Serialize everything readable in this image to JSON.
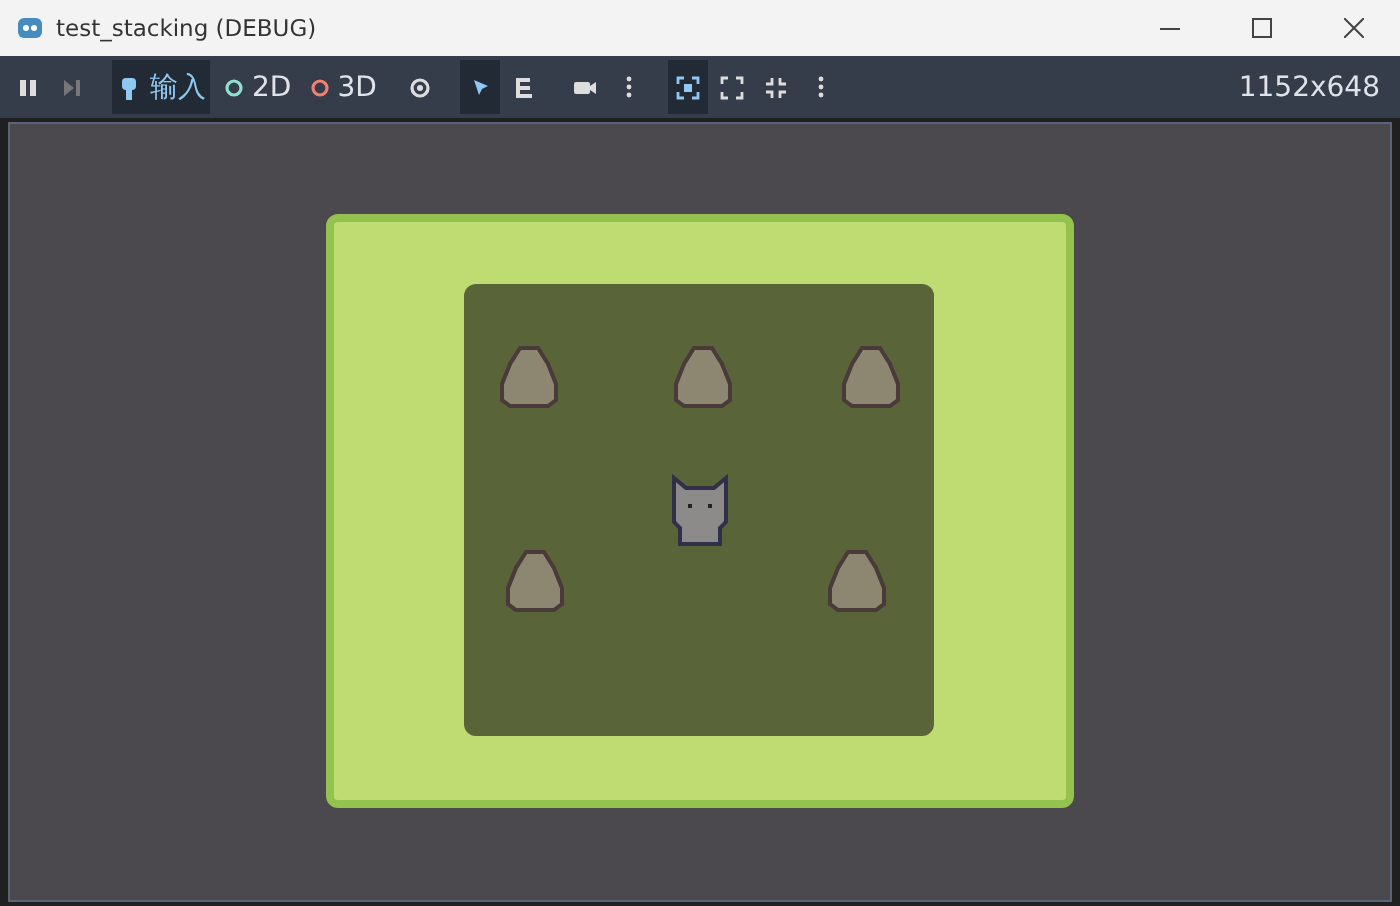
{
  "window": {
    "title": "test_stacking (DEBUG)"
  },
  "toolbar": [
    {
      "kind": "pause",
      "selected": false
    },
    {
      "kind": "step",
      "selected": false
    },
    {
      "kind": "input",
      "label": "输入",
      "selected": true
    },
    {
      "kind": "mode2d",
      "label": "2D",
      "selected": false
    },
    {
      "kind": "mode3d",
      "label": "3D",
      "selected": false
    },
    {
      "kind": "eye",
      "selected": false
    },
    {
      "kind": "pointer",
      "selected": true
    },
    {
      "kind": "list",
      "selected": false
    },
    {
      "kind": "camera",
      "selected": false
    },
    {
      "kind": "more",
      "selected": false
    },
    {
      "kind": "focus",
      "selected": true
    },
    {
      "kind": "expand",
      "selected": false
    },
    {
      "kind": "shrink",
      "selected": false
    },
    {
      "kind": "more",
      "selected": false
    }
  ],
  "resolution": "1152x648"
}
